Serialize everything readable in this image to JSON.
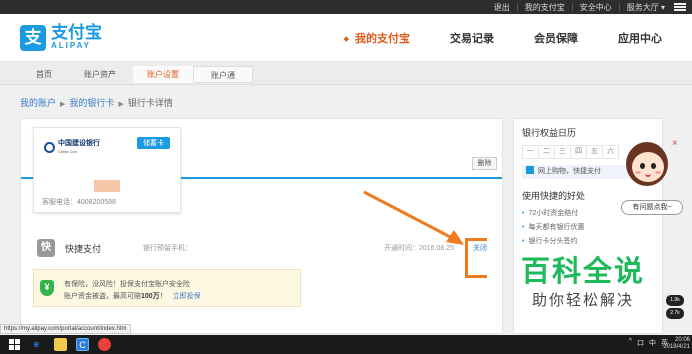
{
  "topbar": {
    "links": [
      "退出",
      "我的支付宝",
      "安全中心",
      "服务大厅 ▾"
    ]
  },
  "logo": {
    "cn": "支付宝",
    "en": "ALIPAY",
    "mark": "支"
  },
  "main_nav": [
    "我的支付宝",
    "交易记录",
    "会员保障",
    "应用中心"
  ],
  "sub_nav": [
    "首页",
    "账户资产",
    "账户设置",
    "账户通"
  ],
  "breadcrumb": [
    "我的账户",
    "我的银行卡",
    "银行卡详情"
  ],
  "card": {
    "bank_name": "中国建设银行",
    "bank_en": "China Con",
    "type": "储蓄卡",
    "phone": "客服电话：4008200588"
  },
  "delete_label": "删除",
  "service": {
    "badge": "快",
    "name": "快捷支付",
    "phone_label": "银行预留手机：",
    "opened": "开通时间：2016.08.25",
    "close_label": "关闭"
  },
  "insurance": {
    "line1": "有保险，没风险！投保支付宝账户安全险",
    "line2_prefix": "账户资金被盗，最高可赔",
    "line2_amount": "100万",
    "line2_suffix": "！",
    "buy_link": "立即投保"
  },
  "sidebar": {
    "calendar_title": "银行权益日历",
    "calendar_cells": [
      "一",
      "二",
      "三",
      "四",
      "五",
      "六"
    ],
    "promo": "网上购物，快捷支付",
    "benefits_title": "使用快捷的好处",
    "benefits": [
      "72小时资金赔付",
      "每天都有银行优惠",
      "银行卡分头签约"
    ]
  },
  "help_pill": "有问题点我~",
  "close_symbol": "×",
  "side_badges": [
    "1.9k",
    "2.7k"
  ],
  "watermark": {
    "big": "百科全说",
    "small": "助你轻松解决"
  },
  "status_url": "https://my.alipay.com/portal/account/index.htm",
  "taskbar": {
    "tray": [
      "^",
      "口",
      "中",
      "英"
    ],
    "time": "20:06",
    "date": "2018/4/21"
  },
  "colors": {
    "accent": "#e05a1c",
    "brand": "#1a9ae0",
    "annotation": "#f07b1e",
    "watermark": "#1fb85a"
  }
}
